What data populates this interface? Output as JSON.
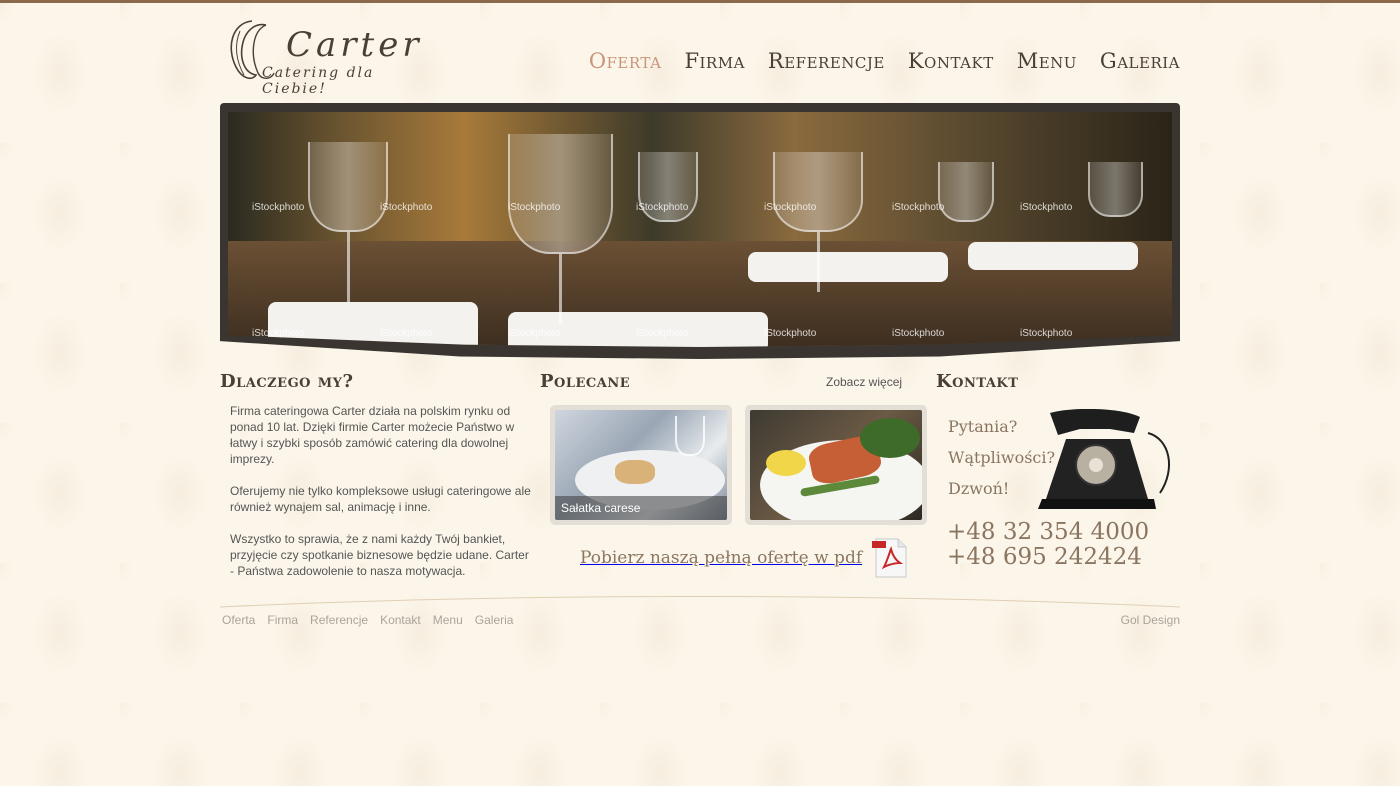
{
  "brand": {
    "name": "Carter",
    "tagline": "Catering dla Ciebie!"
  },
  "nav": {
    "items": [
      {
        "label": "Oferta",
        "active": true
      },
      {
        "label": "Firma",
        "active": false
      },
      {
        "label": "Referencje",
        "active": false
      },
      {
        "label": "Kontakt",
        "active": false
      },
      {
        "label": "Menu",
        "active": false
      },
      {
        "label": "Galeria",
        "active": false
      }
    ]
  },
  "banner": {
    "watermark": "iStockphoto"
  },
  "why": {
    "heading": "Dlaczego my?",
    "paragraphs": [
      "Firma cateringowa Carter  działa na polskim rynku od ponad 10 lat. Dzięki firmie Carter możecie Państwo w łatwy i szybki sposób zamówić catering dla dowolnej imprezy.",
      "Oferujemy nie tylko kompleksowe usługi cateringowe ale również wynajem sal, animację i inne.",
      "Wszystko to sprawia, że z nami każdy Twój bankiet, przyjęcie czy spotkanie biznesowe będzie udane. Carter - Państwa zadowolenie to nasza motywacja."
    ]
  },
  "recommended": {
    "heading": "Polecane",
    "more_label": "Zobacz więcej",
    "items": [
      {
        "caption": "Sałatka carese"
      },
      {
        "caption": ""
      }
    ],
    "pdf_label": "Pobierz naszą pełną ofertę w pdf"
  },
  "contact": {
    "heading": "Kontakt",
    "questions": [
      "Pytania?",
      "Wątpliwości?",
      "Dzwoń!"
    ],
    "phones": [
      "+48 32 354 4000",
      "+48 695 242424"
    ]
  },
  "footer": {
    "nav": [
      "Oferta",
      "Firma",
      "Referencje",
      "Kontakt",
      "Menu",
      "Galeria"
    ],
    "credit": "Gol Design"
  },
  "colors": {
    "background": "#fcf6ea",
    "top_border": "#8a6a4a",
    "nav_active": "#c9957a",
    "text_dark": "#4a3f36",
    "accent_brown": "#8a7560"
  }
}
